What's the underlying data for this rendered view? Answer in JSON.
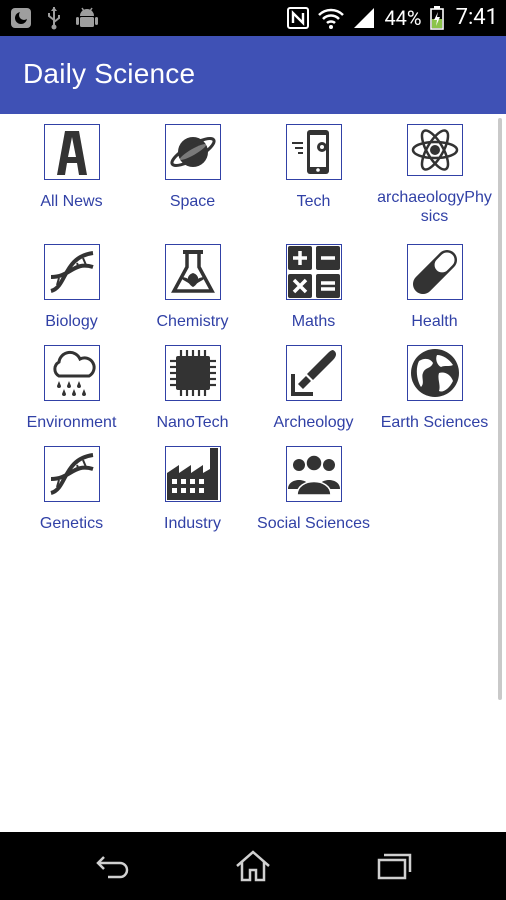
{
  "status_bar": {
    "battery": "44%",
    "time": "7:41",
    "icons": [
      "moon-icon",
      "usb-icon",
      "android-icon",
      "nfc-icon",
      "wifi-icon",
      "signal-icon",
      "battery-charging-icon"
    ]
  },
  "app_bar": {
    "title": "Daily Science"
  },
  "categories": [
    {
      "label": "All News",
      "icon": "letter-a-icon"
    },
    {
      "label": "Space",
      "icon": "planet-icon"
    },
    {
      "label": "Tech",
      "icon": "smartphone-gear-icon"
    },
    {
      "label": "archaeologyPhysics",
      "icon": "atom-icon"
    },
    {
      "label": "Biology",
      "icon": "dna-icon"
    },
    {
      "label": "Chemistry",
      "icon": "flask-leaf-icon"
    },
    {
      "label": "Maths",
      "icon": "calculator-symbols-icon"
    },
    {
      "label": "Health",
      "icon": "pill-icon"
    },
    {
      "label": "Environment",
      "icon": "rain-cloud-icon"
    },
    {
      "label": "NanoTech",
      "icon": "chip-icon"
    },
    {
      "label": "Archeology",
      "icon": "brush-icon"
    },
    {
      "label": "Earth Sciences",
      "icon": "globe-icon"
    },
    {
      "label": "Genetics",
      "icon": "dna-icon"
    },
    {
      "label": "Industry",
      "icon": "factory-icon"
    },
    {
      "label": "Social Sciences",
      "icon": "people-group-icon"
    }
  ],
  "nav_bar": {
    "icons": [
      "back-icon",
      "home-icon",
      "recents-icon"
    ]
  },
  "colors": {
    "primary": "#3f51b5",
    "label": "#3141a6",
    "icon": "#333333"
  }
}
